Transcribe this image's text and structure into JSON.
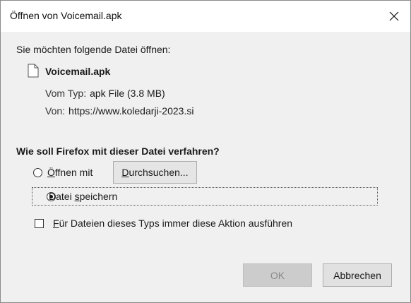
{
  "dialog": {
    "title": "Öffnen von Voicemail.apk",
    "close_icon": "close-icon"
  },
  "file": {
    "prompt": "Sie möchten folgende Datei öffnen:",
    "icon": "file-icon",
    "name": "Voicemail.apk",
    "type_label": "Vom Typ:",
    "type_value": "apk File (3.8 MB)",
    "from_label": "Von:",
    "from_value": "https://www.koledarji-2023.si"
  },
  "action": {
    "question": "Wie soll Firefox mit dieser Datei verfahren?",
    "open_with": {
      "mnemonic": "Ö",
      "rest": "ffnen mit",
      "selected": false
    },
    "browse_button": {
      "mnemonic": "D",
      "rest": "urchsuchen..."
    },
    "save_file": {
      "before": "Datei ",
      "mnemonic": "s",
      "rest": "peichern",
      "selected": true
    },
    "always_do": {
      "mnemonic": "F",
      "rest": "ür Dateien dieses Typs immer diese Aktion ausführen",
      "checked": false
    }
  },
  "buttons": {
    "ok": "OK",
    "cancel": "Abbrechen"
  }
}
